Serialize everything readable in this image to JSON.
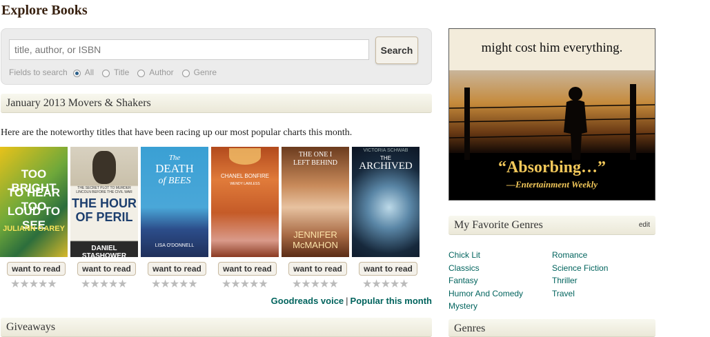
{
  "page_title": "Explore Books",
  "search": {
    "placeholder": "title, author, or ISBN",
    "button_label": "Search",
    "fields_label": "Fields to search",
    "options": [
      "All",
      "Title",
      "Author",
      "Genre"
    ],
    "selected": "All"
  },
  "movers": {
    "heading": "January 2013 Movers & Shakers",
    "intro": "Here are the noteworthy titles that have been racing up our most popular charts this month.",
    "want_label": "want to read",
    "stars": "★★★★★",
    "books": [
      {
        "cover_lines": [
          "TOO BRIGHT",
          "TO HEAR TOO",
          "LOUD TO SEE",
          "JULIANN GAREY"
        ]
      },
      {
        "cover_lines": [
          "THE SECRET PLOT TO MURDER LINCOLN BEFORE THE CIVIL WAR",
          "THE HOUR",
          "OF PERIL",
          "DANIEL STASHOWER"
        ]
      },
      {
        "cover_lines": [
          "The",
          "DEATH",
          "of BEES",
          "LISA O'DONNELL"
        ]
      },
      {
        "cover_lines": [
          "CHANEL BONFIRE",
          "WENDY LAWLESS"
        ]
      },
      {
        "cover_lines": [
          "THE ONE I",
          "LEFT BEHIND",
          "JENNIFER",
          "McMAHON"
        ]
      },
      {
        "cover_lines": [
          "VICTORIA SCHWAB",
          "THE",
          "ARCHIVED"
        ]
      }
    ],
    "link_voice": "Goodreads voice",
    "link_sep": "|",
    "link_popular": "Popular this month"
  },
  "giveaways": {
    "heading": "Giveaways"
  },
  "ad": {
    "top_text": "might cost him everything.",
    "quote": "“Absorbing…”",
    "source": "—Entertainment Weekly"
  },
  "favorite_genres": {
    "heading": "My Favorite Genres",
    "edit_label": "edit",
    "col1": [
      "Chick Lit",
      "Classics",
      "Fantasy",
      "Humor And Comedy",
      "Mystery"
    ],
    "col2": [
      "Romance",
      "Science Fiction",
      "Thriller",
      "Travel"
    ]
  },
  "genres": {
    "heading": "Genres"
  },
  "colors": {
    "link": "#00635d",
    "title": "#382110",
    "button_bg": "#f4f1ea"
  }
}
